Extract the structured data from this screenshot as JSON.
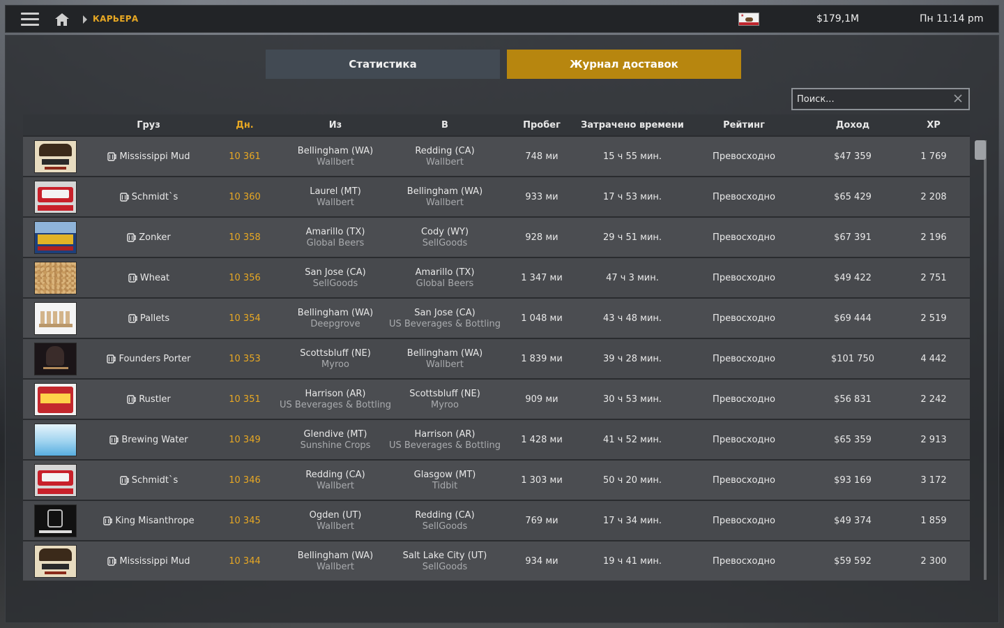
{
  "topbar": {
    "breadcrumb": "КАРЬЕРА",
    "money": "$179,1M",
    "clock": "Пн 11:14 pm"
  },
  "tabs": [
    {
      "label": "Статистика",
      "active": false
    },
    {
      "label": "Журнал доставок",
      "active": true
    }
  ],
  "search": {
    "placeholder": "Поиск..."
  },
  "columns": {
    "cargo": "Груз",
    "day": "Дн.",
    "from": "Из",
    "to": "В",
    "distance": "Пробег",
    "time": "Затрачено времени",
    "rating": "Рейтинг",
    "income": "Доход",
    "xp": "XP"
  },
  "rows": [
    {
      "cargo": "Mississippi Mud",
      "thumb": "mississippi",
      "day": "10 361",
      "from_city": "Bellingham (WA)",
      "from_company": "Wallbert",
      "to_city": "Redding (CA)",
      "to_company": "Wallbert",
      "distance": "748 ми",
      "time": "15 ч 55 мин.",
      "rating": "Превосходно",
      "income": "$47 359",
      "xp": "1 769"
    },
    {
      "cargo": "Schmidt`s",
      "thumb": "schmidts",
      "day": "10 360",
      "from_city": "Laurel (MT)",
      "from_company": "Wallbert",
      "to_city": "Bellingham (WA)",
      "to_company": "Wallbert",
      "distance": "933 ми",
      "time": "17 ч 53 мин.",
      "rating": "Превосходно",
      "income": "$65 429",
      "xp": "2 208"
    },
    {
      "cargo": "Zonker",
      "thumb": "zonker",
      "day": "10 358",
      "from_city": "Amarillo (TX)",
      "from_company": "Global Beers",
      "to_city": "Cody (WY)",
      "to_company": "SellGoods",
      "distance": "928 ми",
      "time": "29 ч 51 мин.",
      "rating": "Превосходно",
      "income": "$67 391",
      "xp": "2 196"
    },
    {
      "cargo": "Wheat",
      "thumb": "wheat",
      "day": "10 356",
      "from_city": "San Jose (CA)",
      "from_company": "SellGoods",
      "to_city": "Amarillo (TX)",
      "to_company": "Global Beers",
      "distance": "1 347 ми",
      "time": "47 ч 3 мин.",
      "rating": "Превосходно",
      "income": "$49 422",
      "xp": "2 751"
    },
    {
      "cargo": "Pallets",
      "thumb": "pallets",
      "day": "10 354",
      "from_city": "Bellingham (WA)",
      "from_company": "Deepgrove",
      "to_city": "San Jose (CA)",
      "to_company": "US Beverages & Bottling",
      "distance": "1 048 ми",
      "time": "43 ч 48 мин.",
      "rating": "Превосходно",
      "income": "$69 444",
      "xp": "2 519"
    },
    {
      "cargo": "Founders Porter",
      "thumb": "founders",
      "day": "10 353",
      "from_city": "Scottsbluff (NE)",
      "from_company": "Myroo",
      "to_city": "Bellingham (WA)",
      "to_company": "Wallbert",
      "distance": "1 839 ми",
      "time": "39 ч 28 мин.",
      "rating": "Превосходно",
      "income": "$101 750",
      "xp": "4 442"
    },
    {
      "cargo": "Rustler",
      "thumb": "rustler",
      "day": "10 351",
      "from_city": "Harrison (AR)",
      "from_company": "US Beverages & Bottling",
      "to_city": "Scottsbluff (NE)",
      "to_company": "Myroo",
      "distance": "909 ми",
      "time": "30 ч 53 мин.",
      "rating": "Превосходно",
      "income": "$56 831",
      "xp": "2 242"
    },
    {
      "cargo": "Brewing Water",
      "thumb": "water",
      "day": "10 349",
      "from_city": "Glendive (MT)",
      "from_company": "Sunshine Crops",
      "to_city": "Harrison (AR)",
      "to_company": "US Beverages & Bottling",
      "distance": "1 428 ми",
      "time": "41 ч 52 мин.",
      "rating": "Превосходно",
      "income": "$65 359",
      "xp": "2 913"
    },
    {
      "cargo": "Schmidt`s",
      "thumb": "schmidts",
      "day": "10 346",
      "from_city": "Redding (CA)",
      "from_company": "Wallbert",
      "to_city": "Glasgow (MT)",
      "to_company": "Tidbit",
      "distance": "1 303 ми",
      "time": "50 ч 20 мин.",
      "rating": "Превосходно",
      "income": "$93 169",
      "xp": "3 172"
    },
    {
      "cargo": "King Misanthrope",
      "thumb": "king",
      "day": "10 345",
      "from_city": "Ogden (UT)",
      "from_company": "Wallbert",
      "to_city": "Redding (CA)",
      "to_company": "SellGoods",
      "distance": "769 ми",
      "time": "17 ч 34 мин.",
      "rating": "Превосходно",
      "income": "$49 374",
      "xp": "1 859"
    },
    {
      "cargo": "Mississippi Mud",
      "thumb": "mississippi",
      "day": "10 344",
      "from_city": "Bellingham (WA)",
      "from_company": "Wallbert",
      "to_city": "Salt Lake City (UT)",
      "to_company": "SellGoods",
      "distance": "934 ми",
      "time": "19 ч 41 мин.",
      "rating": "Превосходно",
      "income": "$59 592",
      "xp": "2 300"
    }
  ],
  "colors": {
    "accent": "#e8a823",
    "active_tab": "#b7860f",
    "inactive_tab": "#424a53"
  }
}
